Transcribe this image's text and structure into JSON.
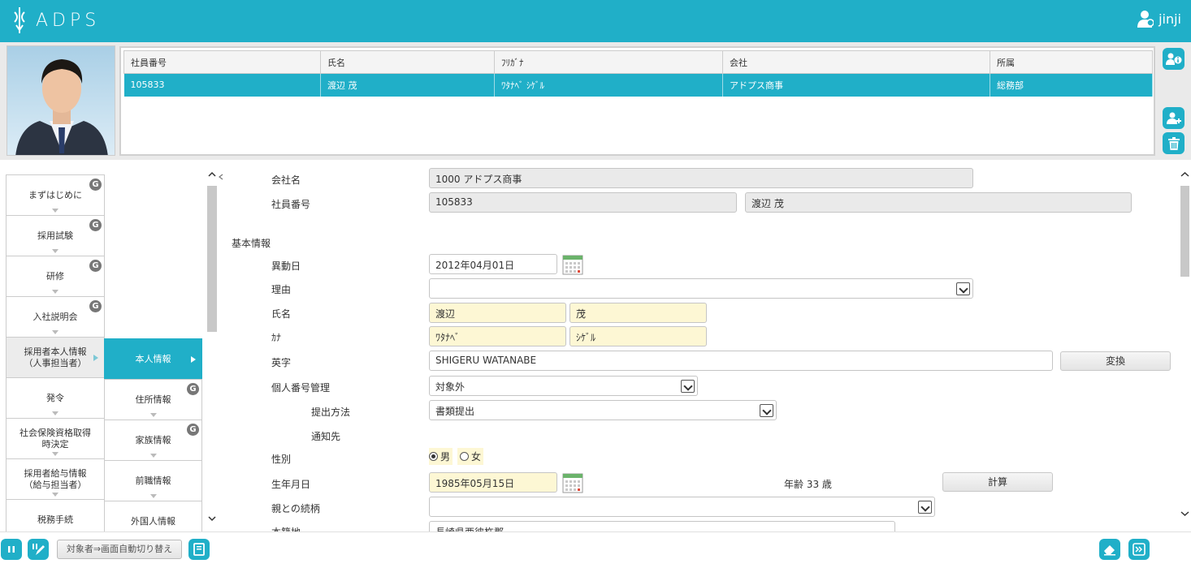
{
  "app": {
    "logo_text": "ADPS",
    "user_name": "jinji",
    "brand_color": "#20afc8"
  },
  "employee_table": {
    "headers": [
      "社員番号",
      "氏名",
      "ﾌﾘｶﾞﾅ",
      "会社",
      "所属"
    ],
    "row": [
      "105833",
      "渡辺 茂",
      "ﾜﾀﾅﾍﾞ ｼｹﾞﾙ",
      "アドプス商事",
      "総務部"
    ]
  },
  "nav": {
    "col1": [
      {
        "label": "まずはじめに",
        "badge": "G"
      },
      {
        "label": "採用試験",
        "badge": "G"
      },
      {
        "label": "研修",
        "badge": "G"
      },
      {
        "label": "入社説明会",
        "badge": "G"
      },
      {
        "label": "採用者本人情報\n（人事担当者）"
      },
      {
        "label": "発令"
      },
      {
        "label": "社会保険資格取得\n時決定"
      },
      {
        "label": "採用者給与情報\n（給与担当者）"
      },
      {
        "label": "税務手続"
      }
    ],
    "col2": [
      {
        "label": "本人情報"
      },
      {
        "label": "住所情報",
        "badge": "G"
      },
      {
        "label": "家族情報",
        "badge": "G"
      },
      {
        "label": "前職情報"
      },
      {
        "label": "外国人情報"
      }
    ]
  },
  "form": {
    "company_label": "会社名",
    "company_value": "1000 アドプス商事",
    "empno_label": "社員番号",
    "empno_value": "105833",
    "empname_value": "渡辺 茂",
    "section_basic": "基本情報",
    "transfer_label": "異動日",
    "transfer_value": "2012年04月01日",
    "reason_label": "理由",
    "reason_value": "",
    "name_label": "氏名",
    "last_name": "渡辺",
    "first_name": "茂",
    "kana_label": "ｶﾅ",
    "last_kana": "ﾜﾀﾅﾍﾞ",
    "first_kana": "ｼｹﾞﾙ",
    "roman_label": "英字",
    "roman_value": "SHIGERU WATANABE",
    "convert_button": "変換",
    "mynumber_label": "個人番号管理",
    "mynumber_value": "対象外",
    "submit_method_label": "提出方法",
    "submit_method_value": "書類提出",
    "notify_label": "通知先",
    "gender_label": "性別",
    "gender_male": "男",
    "gender_female": "女",
    "gender_selected": "male",
    "birth_label": "生年月日",
    "birth_value": "1985年05月15日",
    "age_text": "年齢 33 歳",
    "calc_button": "計算",
    "relation_label": "親との続柄",
    "relation_value": "",
    "domicile_label": "本籍地",
    "domicile_value": "長崎県西彼杵郡"
  },
  "footer": {
    "auto_switch_label": "対象者⇒画面自動切り替え"
  }
}
